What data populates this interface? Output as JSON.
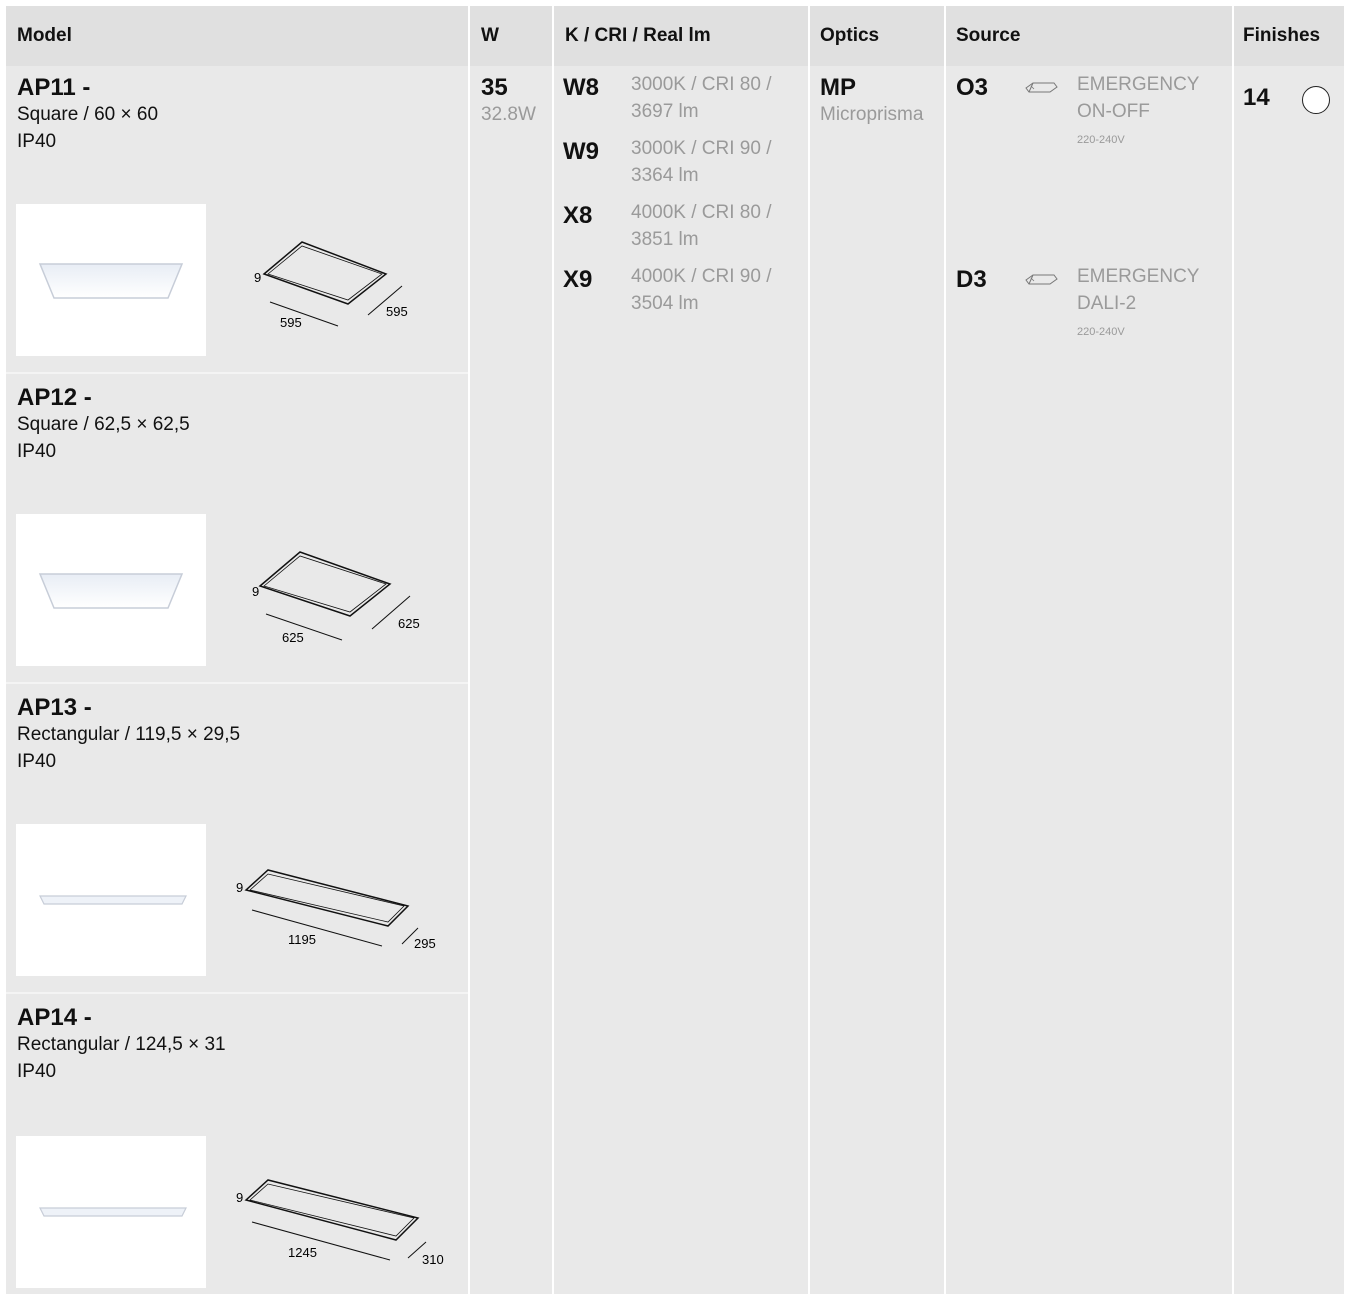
{
  "headers": {
    "model": "Model",
    "w": "W",
    "kcri": "K / CRI / Real lm",
    "optics": "Optics",
    "source": "Source",
    "finishes": "Finishes"
  },
  "models": [
    {
      "code": "AP11 -",
      "desc": "Square / 60 × 60",
      "ip": "IP40",
      "dim_h": "9",
      "dim_l": "595",
      "dim_w": "595"
    },
    {
      "code": "AP12 -",
      "desc": "Square / 62,5 × 62,5",
      "ip": "IP40",
      "dim_h": "9",
      "dim_l": "625",
      "dim_w": "625"
    },
    {
      "code": "AP13 -",
      "desc": "Rectangular / 119,5 × 29,5",
      "ip": "IP40",
      "dim_h": "9",
      "dim_l": "1195",
      "dim_w": "295"
    },
    {
      "code": "AP14 -",
      "desc": "Rectangular / 124,5 × 31",
      "ip": "IP40",
      "dim_h": "9",
      "dim_l": "1245",
      "dim_w": "310"
    }
  ],
  "watt": {
    "code": "35",
    "value": "32.8W"
  },
  "kcri": [
    {
      "code": "W8",
      "line1": "3000K / CRI 80 /",
      "line2": "3697 lm"
    },
    {
      "code": "W9",
      "line1": "3000K / CRI 90 /",
      "line2": "3364 lm"
    },
    {
      "code": "X8",
      "line1": "4000K / CRI 80 /",
      "line2": "3851 lm"
    },
    {
      "code": "X9",
      "line1": "4000K / CRI 90 /",
      "line2": "3504 lm"
    }
  ],
  "optics": {
    "code": "MP",
    "name": "Microprisma"
  },
  "sources": [
    {
      "code": "O3",
      "icon": "emergency-driver-icon",
      "line1": "EMERGENCY",
      "line2": "ON-OFF",
      "voltage": "220-240V"
    },
    {
      "code": "D3",
      "icon": "emergency-driver-icon",
      "line1": "EMERGENCY",
      "line2": "DALI-2",
      "voltage": "220-240V"
    }
  ],
  "finishes": {
    "code": "14",
    "swatch_color": "#ffffff"
  }
}
